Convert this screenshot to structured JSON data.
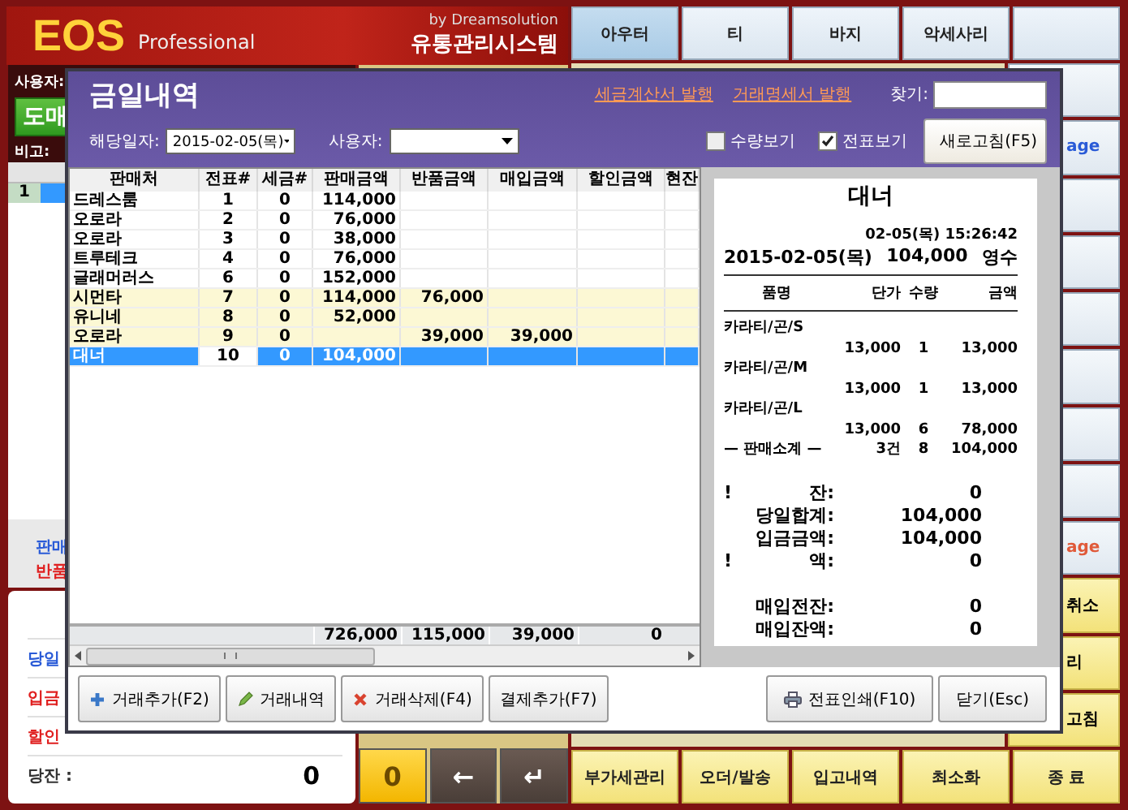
{
  "header": {
    "logo": "EOS",
    "edition": "Professional",
    "vendor": "by Dreamsolution",
    "product": "유통관리시스템"
  },
  "left_panel": {
    "user_label": "사용자:",
    "mode_button": "도매",
    "note_label": "비고:",
    "list_rows": [
      {
        "number": "1",
        "selected": true
      }
    ],
    "legend": [
      {
        "label": "판매",
        "color": "#2a5bd7"
      },
      {
        "label": "반품",
        "color": "#e02020"
      }
    ],
    "totals": [
      {
        "label": "당일",
        "color": "#2a5bd7"
      },
      {
        "label": "입금",
        "color": "#e02020"
      },
      {
        "label": "할인",
        "color": "#e02020"
      },
      {
        "label": "당잔 :",
        "value": "0",
        "color": "#333333"
      }
    ]
  },
  "keys": [
    {
      "label": "0",
      "kind": "number"
    },
    {
      "label": "←",
      "kind": "arrow"
    },
    {
      "label": "↵",
      "kind": "arrow"
    }
  ],
  "category_buttons": [
    {
      "label": "아우터",
      "selected": true
    },
    {
      "label": "티",
      "selected": false
    },
    {
      "label": "바지",
      "selected": false
    },
    {
      "label": "악세사리",
      "selected": false
    },
    {
      "selected": false
    }
  ],
  "side_buttons": [
    {
      "kind": "plain"
    },
    {
      "kind": "plain",
      "label": "age",
      "color": "#2a5bd7"
    },
    {
      "kind": "plain"
    },
    {
      "kind": "plain"
    },
    {
      "kind": "plain"
    },
    {
      "kind": "plain"
    },
    {
      "kind": "plain"
    },
    {
      "kind": "plain"
    },
    {
      "kind": "plain",
      "label": "age",
      "color": "#e05a3a"
    },
    {
      "kind": "yellow",
      "label": "취소"
    },
    {
      "kind": "yellow",
      "label": "리"
    },
    {
      "kind": "yellow",
      "label": "고침"
    }
  ],
  "function_buttons": [
    "부가세관리",
    "오더/발송",
    "입고내역",
    "최소화",
    "종 료"
  ],
  "dialog": {
    "title": "금일내역",
    "links": [
      "세금계산서 발행",
      "거래명세서 발행"
    ],
    "search": {
      "label": "찾기:"
    },
    "date": {
      "label": "해당일자:",
      "value": "2015-02-05(목)"
    },
    "user": {
      "label": "사용자:"
    },
    "checkboxes": [
      {
        "label": "수량보기",
        "checked": false
      },
      {
        "label": "전표보기",
        "checked": true
      }
    ],
    "refresh_button": "새로고침(F5)",
    "table": {
      "columns": [
        "판매처",
        "전표#",
        "세금#",
        "판매금액",
        "반품금액",
        "매입금액",
        "할인금액",
        "현잔"
      ],
      "rows": [
        {
          "cells": [
            "드레스룸",
            "1",
            "0",
            "114,000",
            null,
            null,
            null,
            null
          ],
          "highlighted": false,
          "selected": false
        },
        {
          "cells": [
            "오로라",
            "2",
            "0",
            "76,000",
            null,
            null,
            null,
            null
          ],
          "highlighted": false,
          "selected": false
        },
        {
          "cells": [
            "오로라",
            "3",
            "0",
            "38,000",
            null,
            null,
            null,
            null
          ],
          "highlighted": false,
          "selected": false
        },
        {
          "cells": [
            "트루테크",
            "4",
            "0",
            "76,000",
            null,
            null,
            null,
            null
          ],
          "highlighted": false,
          "selected": false
        },
        {
          "cells": [
            "글래머러스",
            "6",
            "0",
            "152,000",
            null,
            null,
            null,
            null
          ],
          "highlighted": false,
          "selected": false
        },
        {
          "cells": [
            "시먼타",
            "7",
            "0",
            "114,000",
            "76,000",
            null,
            null,
            null
          ],
          "highlighted": true,
          "selected": false
        },
        {
          "cells": [
            "유니네",
            "8",
            "0",
            "52,000",
            null,
            null,
            null,
            null
          ],
          "highlighted": true,
          "selected": false
        },
        {
          "cells": [
            "오로라",
            "9",
            "0",
            null,
            "39,000",
            "39,000",
            null,
            null
          ],
          "highlighted": true,
          "selected": false
        },
        {
          "cells": [
            "대너",
            "10",
            "0",
            "104,000",
            null,
            null,
            null,
            null
          ],
          "highlighted": false,
          "selected": true
        }
      ],
      "totals": {
        "sales": "726,000",
        "returns": "115,000",
        "purchase": "39,000",
        "discount": "0"
      }
    },
    "receipt": {
      "title": "대너",
      "timestamp": "02-05(목) 15:26:42",
      "date": "2015-02-05(목)",
      "total": "104,000",
      "type": "영수",
      "columns": [
        "품명",
        "단가",
        "수량",
        "금액"
      ],
      "items": [
        {
          "name": "카라티/곤/S",
          "price": "13,000",
          "qty": "1",
          "amount": "13,000"
        },
        {
          "name": "카라티/곤/M",
          "price": "13,000",
          "qty": "1",
          "amount": "13,000"
        },
        {
          "name": "카라티/곤/L",
          "price": "13,000",
          "qty": "6",
          "amount": "78,000"
        }
      ],
      "subtotal": {
        "label": "— 판매소계 —",
        "count": "3건",
        "qty": "8",
        "amount": "104,000"
      },
      "summary": [
        {
          "mark": "!",
          "label": "잔:",
          "value": "0"
        },
        {
          "label": "당일합계:",
          "value": "104,000"
        },
        {
          "label": "입금금액:",
          "value": "104,000"
        },
        {
          "mark": "!",
          "label": "액:",
          "value": "0"
        }
      ],
      "purchase_summary": [
        {
          "label": "매입전잔:",
          "value": "0"
        },
        {
          "label": "매입잔액:",
          "value": "0"
        }
      ]
    },
    "left_buttons": [
      "거래추가(F2)",
      "거래내역",
      "거래삭제(F4)",
      "결제추가(F7)"
    ],
    "right_buttons": [
      "전표인쇄(F10)",
      "닫기(Esc)"
    ]
  }
}
